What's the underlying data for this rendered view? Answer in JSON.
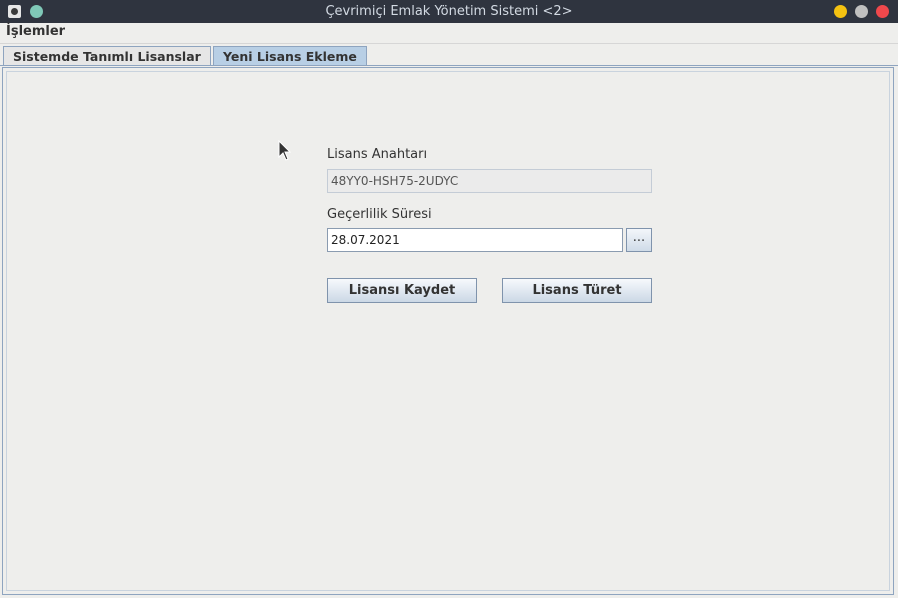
{
  "window": {
    "title": "Çevrimiçi Emlak Yönetim Sistemi <2>"
  },
  "menubar": {
    "items": [
      {
        "label": "İşlemler"
      }
    ]
  },
  "tabs": [
    {
      "label": "Sistemde Tanımlı Lisanslar",
      "selected": false
    },
    {
      "label": "Yeni Lisans Ekleme",
      "selected": true
    }
  ],
  "form": {
    "license_key_label": "Lisans Anahtarı",
    "license_key_value": "48YY0-HSH75-2UDYC",
    "validity_label": "Geçerlilik Süresi",
    "validity_value": "28.07.2021",
    "picker_label": "...",
    "save_label": "Lisansı Kaydet",
    "derive_label": "Lisans Türet"
  },
  "colors": {
    "titlebar": "#2f343f",
    "selected_tab": "#b8cfe5",
    "minimize": "#f5c211",
    "maximize": "#c0c0c0",
    "close": "#f0484c"
  }
}
